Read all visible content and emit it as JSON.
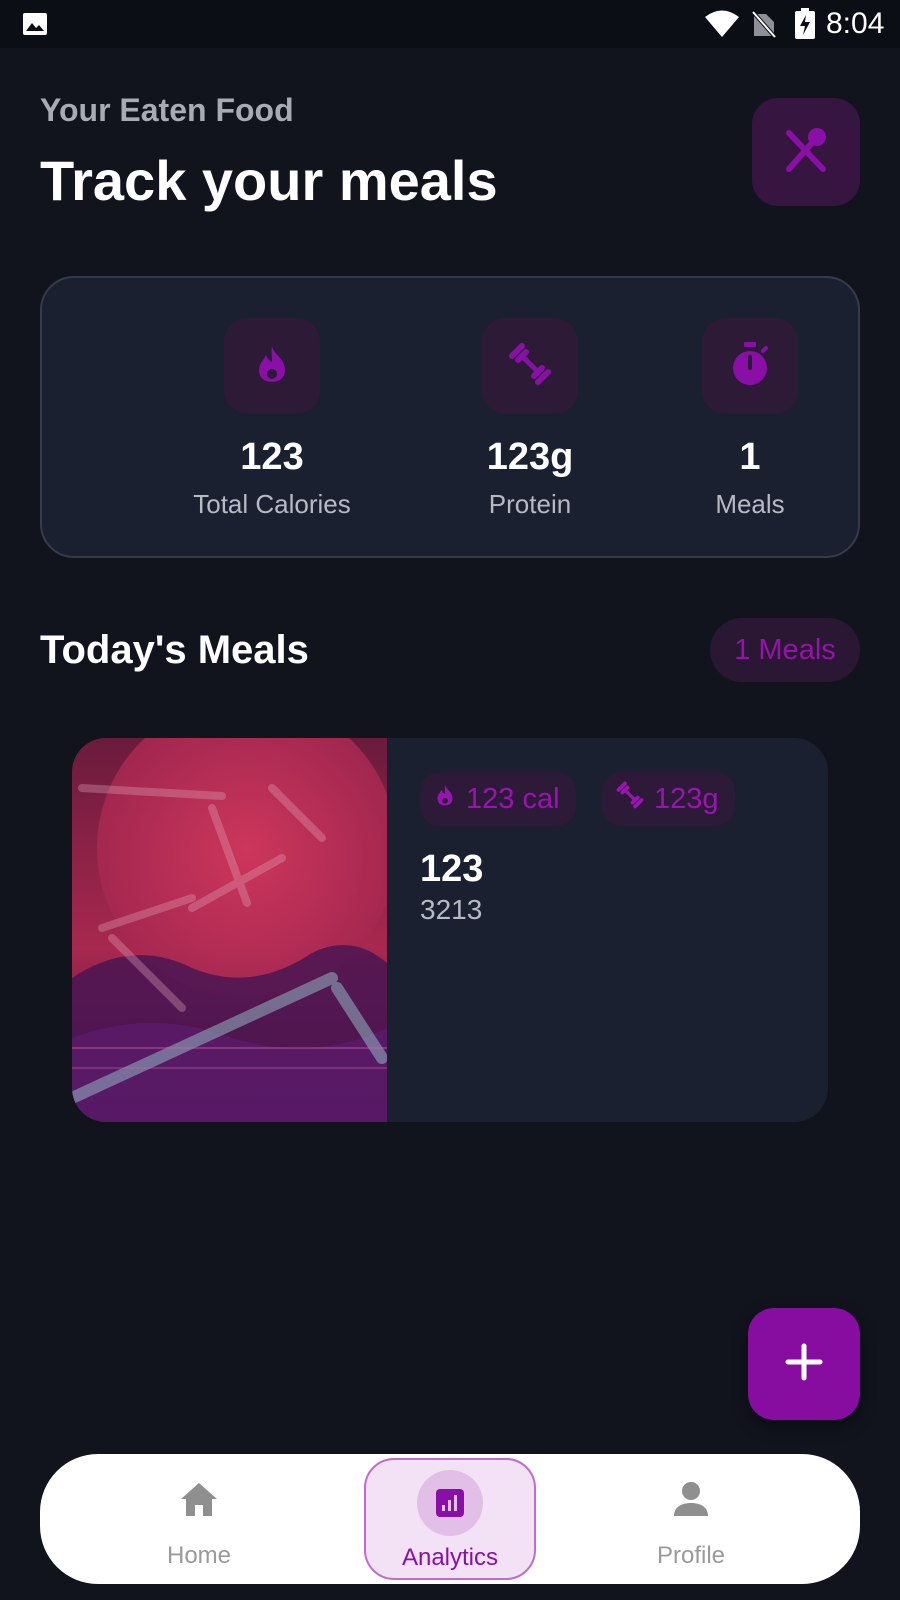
{
  "status_bar": {
    "time": "8:04"
  },
  "header": {
    "subtitle": "Your Eaten Food",
    "title": "Track your meals",
    "action_icon": "utensils-icon"
  },
  "stats": [
    {
      "icon": "flame-icon",
      "value": "123",
      "label": "Total Calories"
    },
    {
      "icon": "dumbbell-icon",
      "value": "123g",
      "label": "Protein"
    },
    {
      "icon": "timer-icon",
      "value": "1",
      "label": "Meals"
    }
  ],
  "section": {
    "title": "Today's Meals",
    "count_badge": "1 Meals"
  },
  "meals": [
    {
      "calories_tag": "123 cal",
      "protein_tag": "123g",
      "name": "123",
      "description": "3213"
    }
  ],
  "fab": {
    "icon": "plus-icon"
  },
  "bottom_nav": {
    "items": [
      {
        "label": "Home",
        "icon": "home-icon",
        "active": false
      },
      {
        "label": "Analytics",
        "icon": "analytics-icon",
        "active": true
      },
      {
        "label": "Profile",
        "icon": "person-icon",
        "active": false
      }
    ]
  },
  "colors": {
    "background": "#11141d",
    "card": "#1b2030",
    "accent": "#870da1",
    "accent_text": "#9612ad",
    "nav_active_bg": "#f3e2f5"
  }
}
